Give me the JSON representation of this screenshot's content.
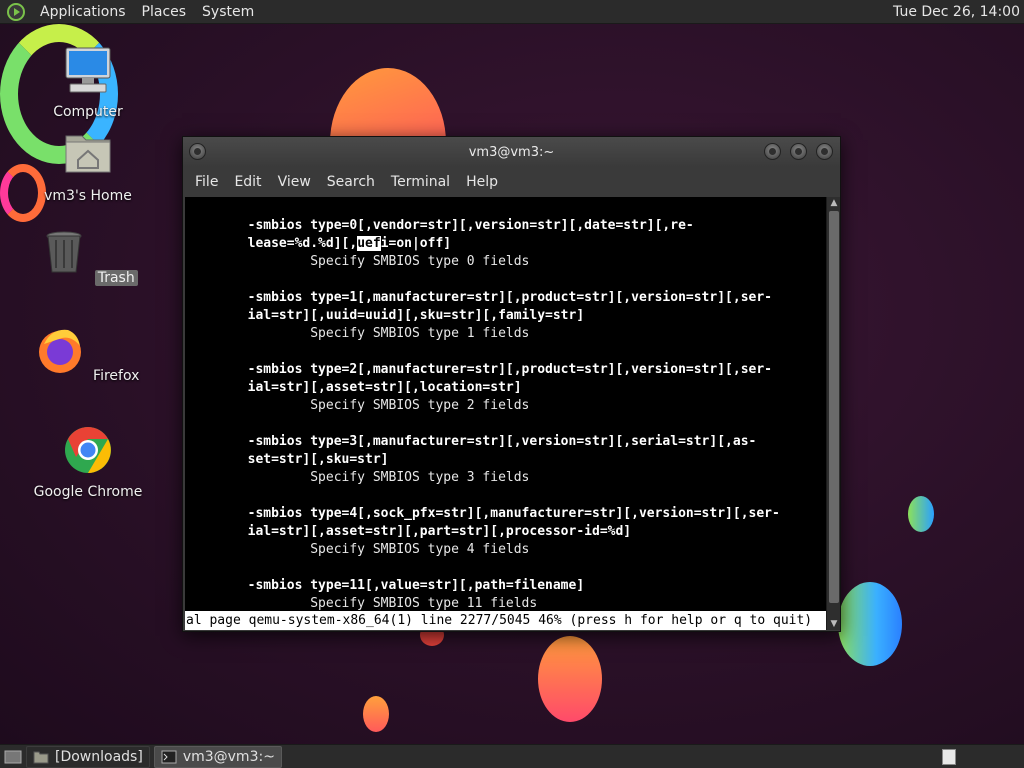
{
  "top_panel": {
    "menus": [
      "Applications",
      "Places",
      "System"
    ],
    "clock": "Tue Dec 26, 14:00"
  },
  "desktop": {
    "icons": [
      {
        "label": "Computer",
        "icon": "computer-icon"
      },
      {
        "label": "vm3's Home",
        "icon": "home-folder-icon"
      },
      {
        "label": "Trash",
        "icon": "trash-icon"
      },
      {
        "label": "Firefox",
        "icon": "firefox-icon"
      },
      {
        "label": "Google Chrome",
        "icon": "chrome-icon"
      }
    ]
  },
  "terminal": {
    "title": "vm3@vm3:~",
    "menu": [
      "File",
      "Edit",
      "View",
      "Search",
      "Terminal",
      "Help"
    ],
    "lines": [
      {
        "text": "        -smbios type=0[,vendor=str][,version=str][,date=str][,re-",
        "bold": true
      },
      {
        "text": "        lease=%d.%d][,uefi=on|off]",
        "bold": true
      },
      {
        "text": "                Specify SMBIOS type 0 fields",
        "bold": false
      },
      {
        "text": "",
        "bold": false
      },
      {
        "text": "        -smbios type=1[,manufacturer=str][,product=str][,version=str][,ser-",
        "bold": true
      },
      {
        "text": "        ial=str][,uuid=uuid][,sku=str][,family=str]",
        "bold": true
      },
      {
        "text": "                Specify SMBIOS type 1 fields",
        "bold": false
      },
      {
        "text": "",
        "bold": false
      },
      {
        "text": "        -smbios type=2[,manufacturer=str][,product=str][,version=str][,ser-",
        "bold": true
      },
      {
        "text": "        ial=str][,asset=str][,location=str]",
        "bold": true
      },
      {
        "text": "                Specify SMBIOS type 2 fields",
        "bold": false
      },
      {
        "text": "",
        "bold": false
      },
      {
        "text": "        -smbios type=3[,manufacturer=str][,version=str][,serial=str][,as-",
        "bold": true
      },
      {
        "text": "        set=str][,sku=str]",
        "bold": true
      },
      {
        "text": "                Specify SMBIOS type 3 fields",
        "bold": false
      },
      {
        "text": "",
        "bold": false
      },
      {
        "text": "        -smbios type=4[,sock_pfx=str][,manufacturer=str][,version=str][,ser-",
        "bold": true
      },
      {
        "text": "        ial=str][,asset=str][,part=str][,processor-id=%d]",
        "bold": true
      },
      {
        "text": "                Specify SMBIOS type 4 fields",
        "bold": false
      },
      {
        "text": "",
        "bold": false
      },
      {
        "text": "        -smbios type=11[,value=str][,path=filename]",
        "bold": true
      },
      {
        "text": "                Specify SMBIOS type 11 fields",
        "bold": false
      }
    ],
    "highlight": {
      "line_index": 1,
      "before": "        lease=%d.%d][,",
      "match": "uef",
      "after": "i=on|off]"
    },
    "status": "al page qemu-system-x86_64(1) line 2277/5045 46% (press h for help or q to quit)",
    "scroll_arrow_up": "▲",
    "scroll_arrow_down": "▼"
  },
  "bottom_panel": {
    "tasks": [
      {
        "label": "[Downloads]",
        "icon": "folder-icon",
        "active": false
      },
      {
        "label": "vm3@vm3:~",
        "icon": "terminal-icon",
        "active": true
      }
    ]
  }
}
